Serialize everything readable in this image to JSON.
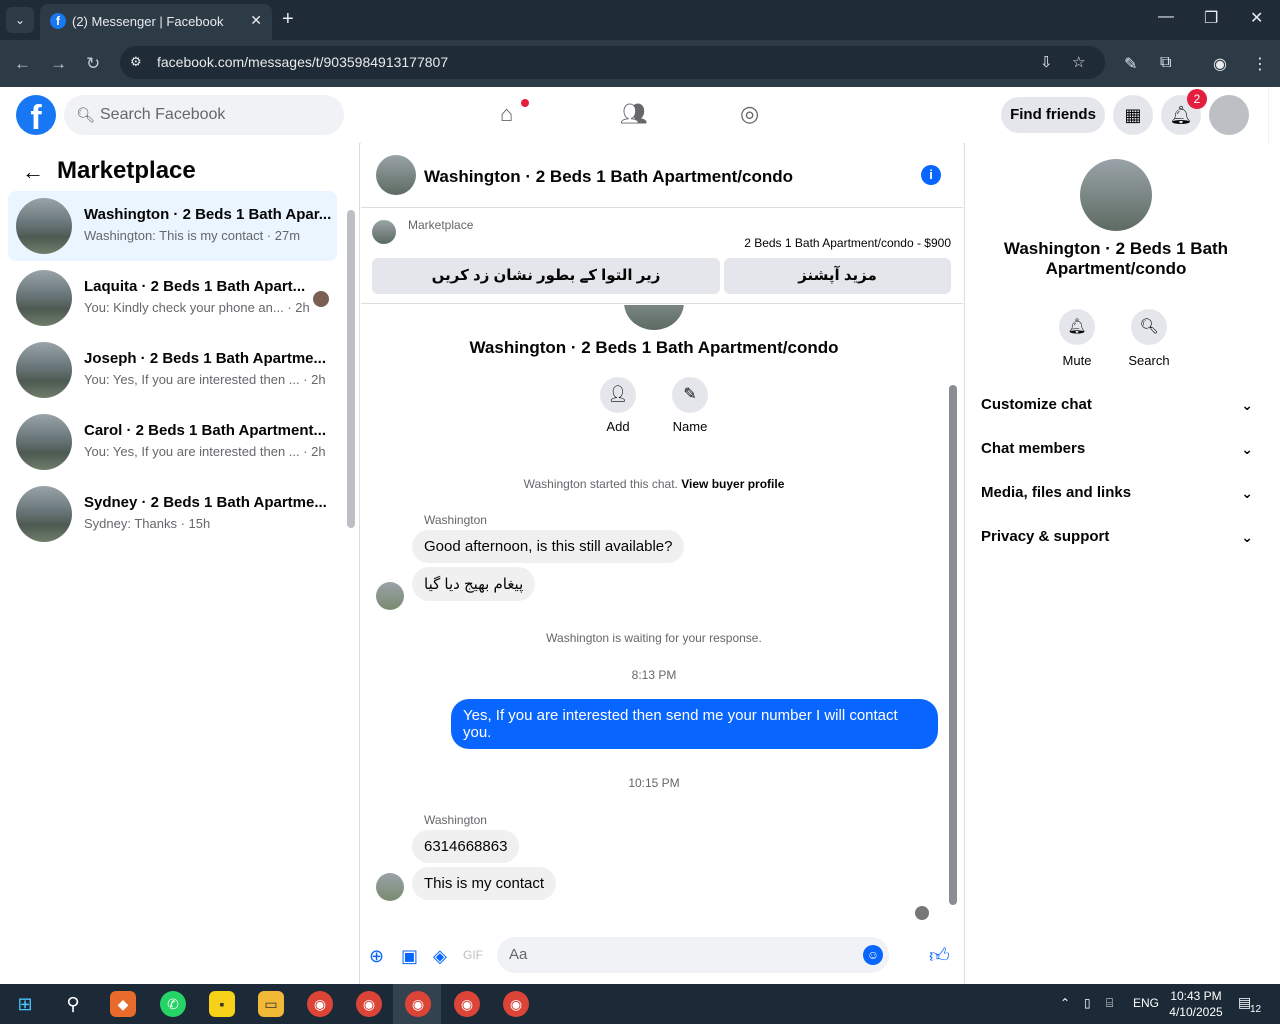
{
  "browser": {
    "tab_title": "(2) Messenger | Facebook",
    "url": "facebook.com/messages/t/9035984913177807"
  },
  "fb": {
    "search_placeholder": "Search Facebook",
    "find_friends": "Find friends",
    "notification_count": "2"
  },
  "left": {
    "title": "Marketplace",
    "conversations": [
      {
        "name": "Washington · 2 Beds 1 Bath Apar...",
        "preview": "Washington: This is my contact · 27m"
      },
      {
        "name": "Laquita · 2 Beds 1 Bath Apart...",
        "preview": "You: Kindly check your phone an... · 2h"
      },
      {
        "name": "Joseph · 2 Beds 1 Bath Apartme...",
        "preview": "You: Yes, If you are interested then ... · 2h"
      },
      {
        "name": "Carol · 2 Beds 1 Bath Apartment...",
        "preview": "You: Yes, If you are interested then ... · 2h"
      },
      {
        "name": "Sydney · 2 Beds 1 Bath Apartme...",
        "preview": "Sydney: Thanks · 15h"
      }
    ]
  },
  "chat": {
    "title": "Washington · 2 Beds 1 Bath Apartment/condo",
    "marketplace_label": "Marketplace",
    "listing_price": "2 Beds 1 Bath Apartment/condo - $900",
    "btn_mark": "زیر التوا کے بطور نشان زد کریں",
    "btn_more": "مزید آپشنز",
    "thread_name": "Washington · 2 Beds 1 Bath Apartment/condo",
    "add_label": "Add",
    "name_label": "Name",
    "started_text": "Washington started this chat.",
    "view_profile": "View buyer profile",
    "sender1": "Washington",
    "msg1": "Good afternoon, is this still available?",
    "msg2": "پیغام بھیج دیا گیا",
    "waiting": "Washington is waiting for your response.",
    "time1": "8:13 PM",
    "my_msg": "Yes, If you are interested then send me your number I will contact you.",
    "time2": "10:15 PM",
    "sender2": "Washington",
    "msg3": "6314668863",
    "msg4": "This is my contact",
    "composer_placeholder": "Aa"
  },
  "right": {
    "name": "Washington · 2 Beds 1 Bath Apartment/condo",
    "mute": "Mute",
    "search": "Search",
    "sections": [
      "Customize chat",
      "Chat members",
      "Media, files and links",
      "Privacy & support"
    ]
  },
  "taskbar": {
    "lang": "ENG",
    "time": "10:43 PM",
    "date": "4/10/2025",
    "notif_count": "12"
  }
}
